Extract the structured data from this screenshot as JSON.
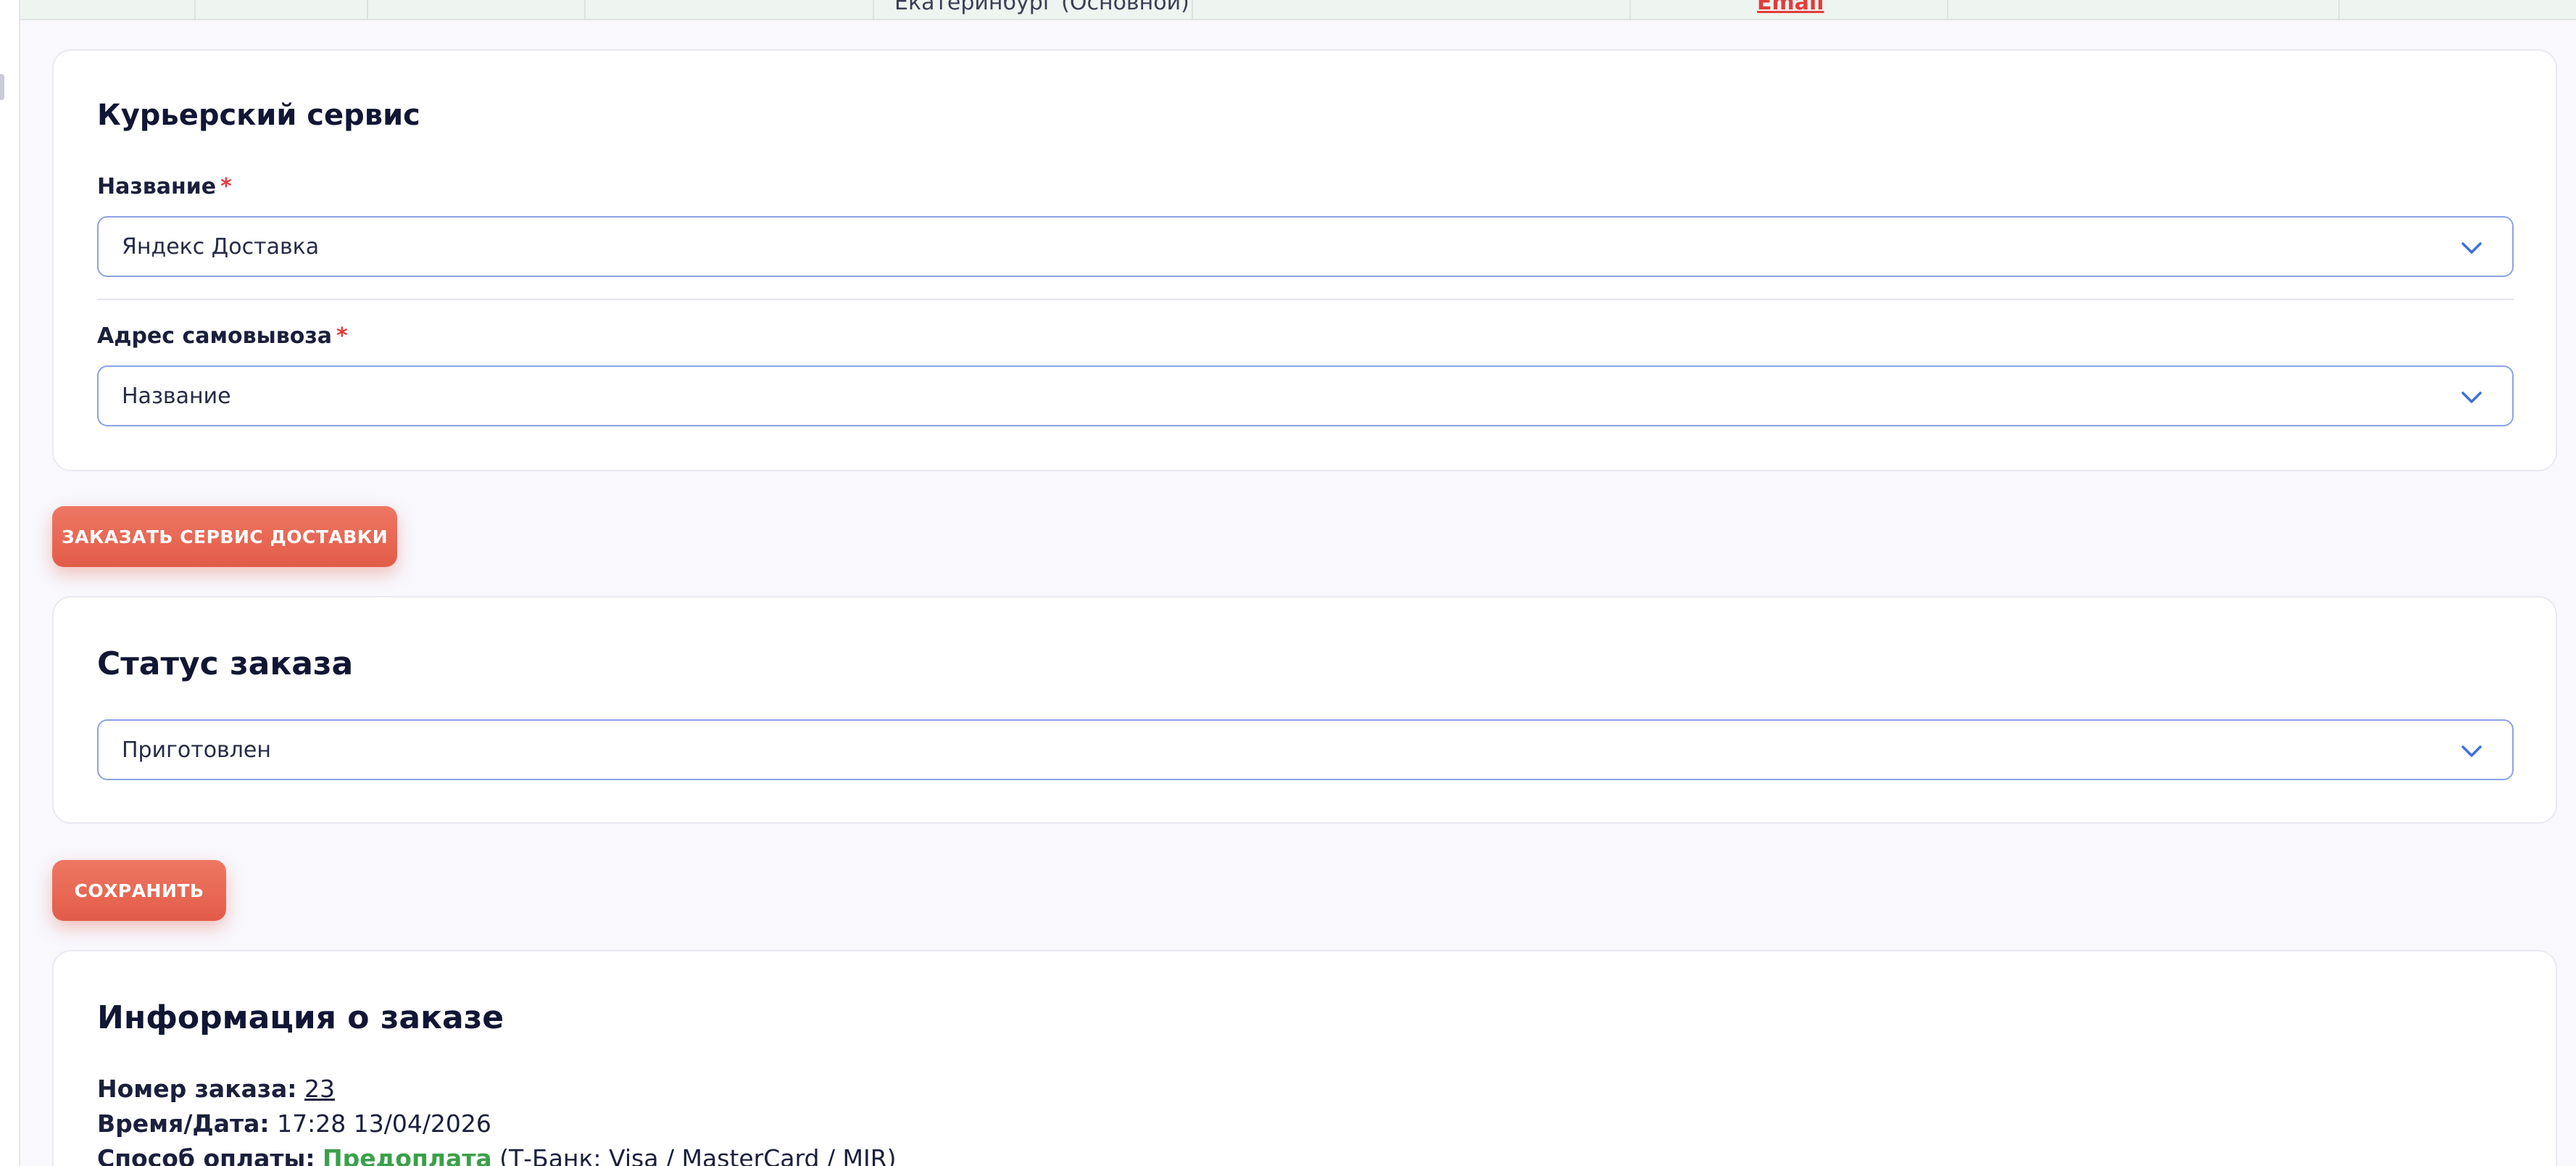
{
  "top_row": {
    "location_text": "Екатеринбург (Основной)",
    "email_link": "Email"
  },
  "courier_card": {
    "title": "Курьерский сервис",
    "name_label": "Название",
    "name_value": "Яндекс Доставка",
    "pickup_label": "Адрес самовывоза",
    "pickup_value": "Название",
    "required_mark": "*"
  },
  "order_delivery_button": "ЗАКАЗАТЬ СЕРВИС ДОСТАВКИ",
  "status_card": {
    "title": "Статус заказа",
    "status_value": "Приготовлен"
  },
  "save_button": "СОХРАНИТЬ",
  "info_card": {
    "title": "Информация о заказе",
    "order_number_label": "Номер заказа:",
    "order_number_value": "23",
    "datetime_label": "Время/Дата:",
    "datetime_value": "17:28 13/04/2026",
    "payment_label": "Способ оплаты:",
    "payment_type": "Предоплата",
    "payment_detail": "(Т-Банк: Visa / MasterCard / MIR)"
  },
  "colors": {
    "accent_button": "#e8644f",
    "select_border": "#8aa3e6",
    "required": "#e33d3d",
    "prepaid_green": "#3aa04a",
    "page_bg": "#f8f8fd"
  },
  "icons": {
    "select_arrow": "chevron-down-icon"
  }
}
